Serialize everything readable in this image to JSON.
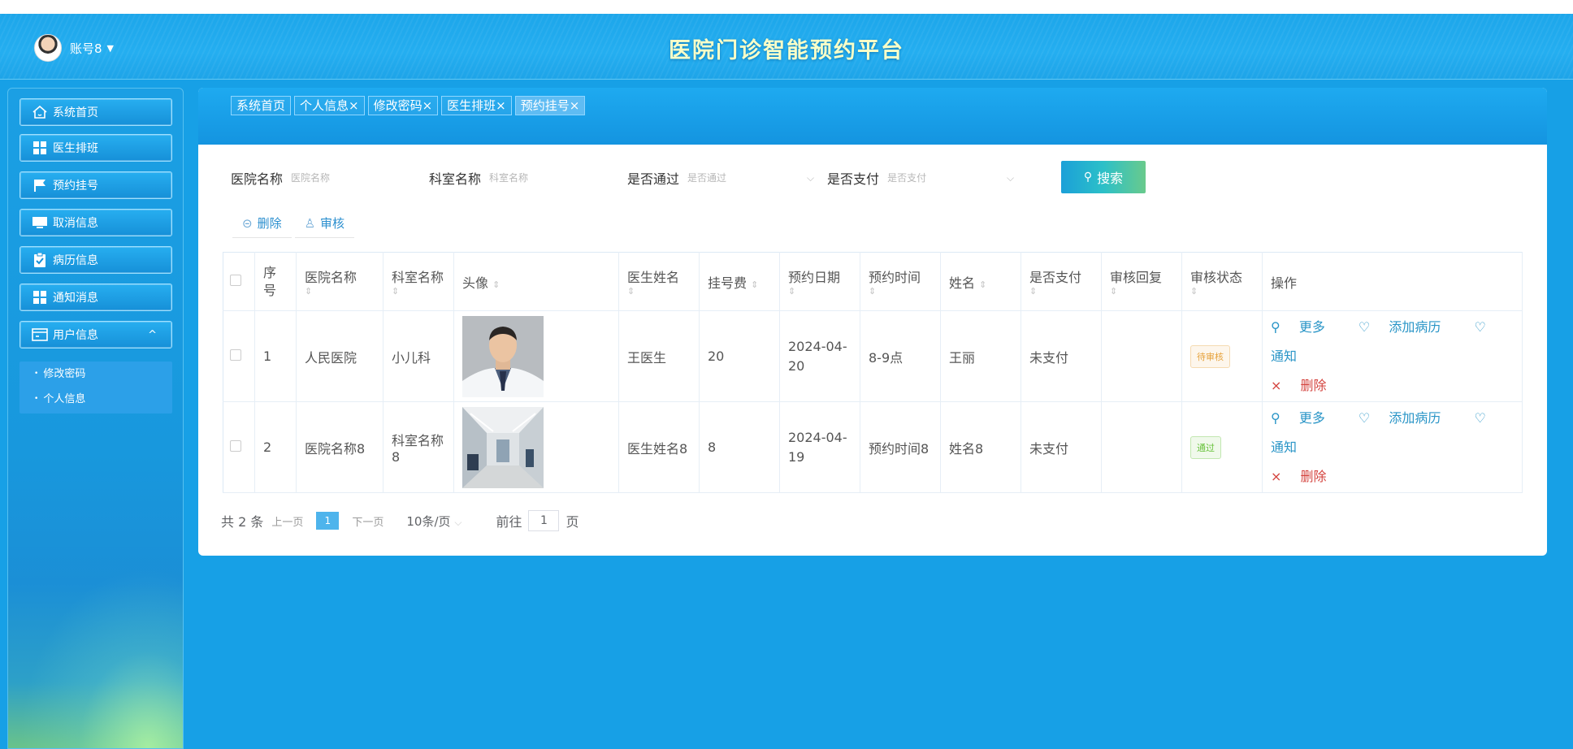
{
  "header": {
    "account_name": "账号8",
    "title": "医院门诊智能预约平台"
  },
  "sidebar": {
    "items": [
      {
        "label": "系统首页",
        "icon": "home-icon"
      },
      {
        "label": "医生排班",
        "icon": "grid-icon"
      },
      {
        "label": "预约挂号",
        "icon": "flag-icon"
      },
      {
        "label": "取消信息",
        "icon": "monitor-icon"
      },
      {
        "label": "病历信息",
        "icon": "clipboard-icon"
      },
      {
        "label": "通知消息",
        "icon": "grid-icon"
      },
      {
        "label": "用户信息",
        "icon": "card-icon"
      }
    ],
    "submenu": [
      "修改密码",
      "个人信息"
    ]
  },
  "tabs": [
    "系统首页",
    "个人信息×",
    "修改密码×",
    "医生排班×",
    "预约挂号×"
  ],
  "search": {
    "hospital_label": "医院名称",
    "hospital_placeholder": "医院名称",
    "dept_label": "科室名称",
    "dept_placeholder": "科室名称",
    "passed_label": "是否通过",
    "passed_placeholder": "是否通过",
    "paid_label": "是否支付",
    "paid_placeholder": "是否支付",
    "button": "搜索"
  },
  "actions": {
    "delete": "删除",
    "audit": "审核"
  },
  "table": {
    "headers": {
      "index": "序号",
      "hospital": "医院名称",
      "dept": "科室名称",
      "photo": "头像",
      "doctor": "医生姓名",
      "fee": "挂号费",
      "date": "预约日期",
      "time": "预约时间",
      "name": "姓名",
      "paid": "是否支付",
      "reply": "审核回复",
      "status": "审核状态",
      "ops": "操作"
    },
    "rows": [
      {
        "index": "1",
        "hospital": "人民医院",
        "dept": "小儿科",
        "doctor": "王医生",
        "fee": "20",
        "date": "2024-04-20",
        "time": "8-9点",
        "name": "王丽",
        "paid": "未支付",
        "reply": "",
        "status": "待审核"
      },
      {
        "index": "2",
        "hospital": "医院名称8",
        "dept": "科室名称8",
        "doctor": "医生姓名8",
        "fee": "8",
        "date": "2024-04-19",
        "time": "预约时间8",
        "name": "姓名8",
        "paid": "未支付",
        "reply": "",
        "status": "通过"
      }
    ],
    "ops": {
      "more": "更多",
      "add_case": "添加病历",
      "notice": "通知",
      "delete": "删除"
    }
  },
  "pager": {
    "total": "共 2 条",
    "prev": "上一页",
    "current": "1",
    "next": "下一页",
    "size": "10条/页",
    "goto": "前往",
    "goto_value": "1",
    "page_unit": "页"
  },
  "colors": {
    "accent": "#17a0e6",
    "title": "#f9ffc8",
    "pending": "#e6a23c",
    "pass": "#67c23a",
    "danger": "#d4443f"
  }
}
